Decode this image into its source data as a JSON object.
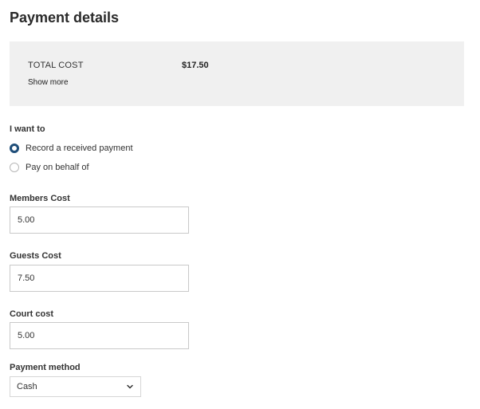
{
  "title": "Payment details",
  "summary": {
    "total_label": "TOTAL COST",
    "total_value": "$17.50",
    "show_more": "Show more"
  },
  "intent": {
    "label": "I want to",
    "options": [
      {
        "label": "Record a received payment",
        "selected": true
      },
      {
        "label": "Pay on behalf of",
        "selected": false
      }
    ]
  },
  "fields": {
    "members_cost": {
      "label": "Members Cost",
      "value": "5.00"
    },
    "guests_cost": {
      "label": "Guests Cost",
      "value": "7.50"
    },
    "court_cost": {
      "label": "Court cost",
      "value": "5.00"
    }
  },
  "payment_method": {
    "label": "Payment method",
    "selected": "Cash"
  },
  "colors": {
    "accent": "#1f4e79",
    "summary_bg": "#f0f0f0"
  }
}
